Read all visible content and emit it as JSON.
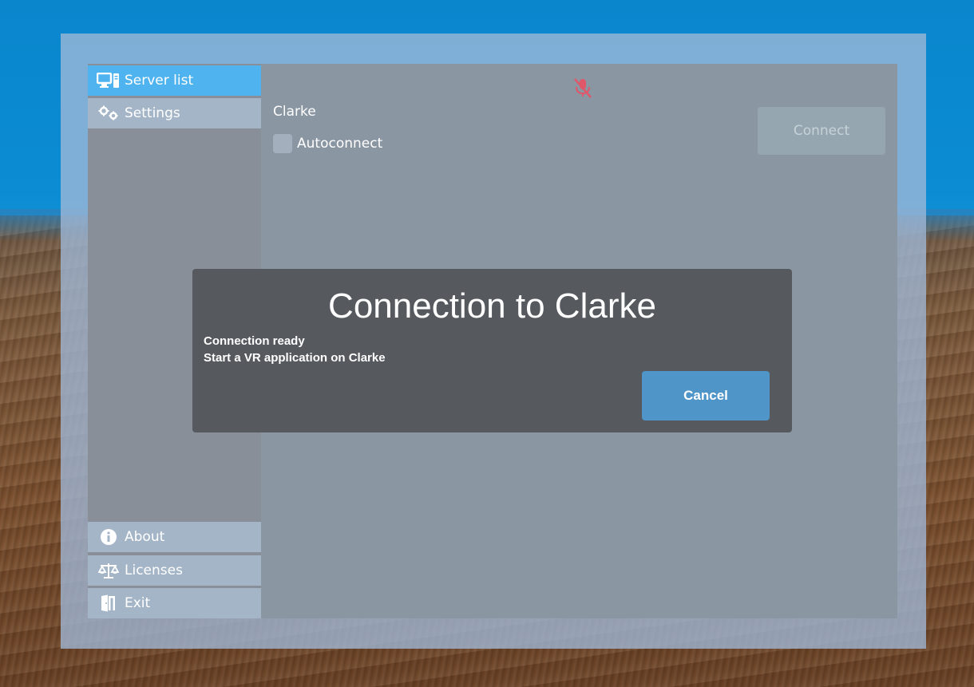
{
  "sidebar": {
    "items": [
      {
        "label": "Server list",
        "icon": "server-list-icon"
      },
      {
        "label": "Settings",
        "icon": "gears-icon"
      }
    ],
    "bottom_items": [
      {
        "label": "About",
        "icon": "info-icon"
      },
      {
        "label": "Licenses",
        "icon": "scales-icon"
      },
      {
        "label": "Exit",
        "icon": "exit-door-icon"
      }
    ]
  },
  "server": {
    "name": "Clarke",
    "autoconnect_label": "Autoconnect",
    "connect_label": "Connect",
    "mic_icon": "muted-microphone-icon"
  },
  "dialog": {
    "title": "Connection to Clarke",
    "status": "Connection ready",
    "hint": "Start a VR application on Clarke",
    "cancel_label": "Cancel"
  },
  "colors": {
    "accent": "#4fb3f0",
    "dialog_bg": "#565a5f",
    "cancel_button": "#4f95c8",
    "mute_icon": "#e0576a"
  }
}
